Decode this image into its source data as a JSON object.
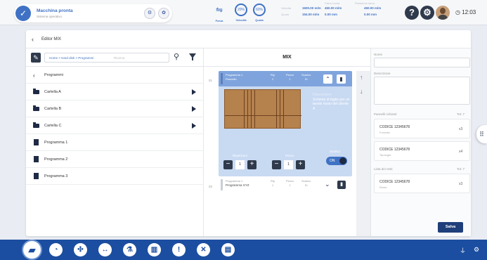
{
  "header": {
    "status_title": "Macchina pronta",
    "status_sub": "Sistema operativo",
    "indicators": [
      {
        "label": "Forza",
        "icon": "feed-icon"
      },
      {
        "label": "Velocità",
        "value": "20%"
      },
      {
        "label": "Quota",
        "value": "60%"
      }
    ],
    "stats": [
      {
        "k": "Velocità",
        "v": "1600.00 m/m"
      },
      {
        "k": "Quota",
        "v": "154.00 m/m"
      },
      {
        "k": "Carro Lama",
        "v": "450.00 m/m"
      },
      {
        "k": "Pezzo",
        "v": "0.00 mm"
      },
      {
        "k": "Rotazione lama",
        "v": "450.00 m/m"
      },
      {
        "k": "Pressione",
        "v": "0.00 mm"
      }
    ],
    "clock": "12:03"
  },
  "breadcrumb": {
    "back_label": "Editor MIX"
  },
  "toolbar": {
    "path": "Home > Hard disk > Programmi",
    "search_placeholder": "Ricerca"
  },
  "list": {
    "header": "Programmi",
    "items": [
      {
        "label": "Cartella A",
        "type": "folder"
      },
      {
        "label": "Cartella B",
        "type": "folder"
      },
      {
        "label": "Cartella C",
        "type": "folder"
      },
      {
        "label": "Programma 1",
        "type": "file"
      },
      {
        "label": "Programma 2",
        "type": "file"
      },
      {
        "label": "Programma 3",
        "type": "file"
      }
    ]
  },
  "mix": {
    "title": "MIX",
    "entries": [
      {
        "num": "01",
        "prog_label": "Programma 1",
        "prog_value": "Pannello",
        "rip_label": "Rip",
        "rip_value": "1",
        "pezzo_label": "Pezzo",
        "pezzo_value": "1",
        "scarico_label": "Scarico",
        "scarico_value": "Sì",
        "desc_label": "Descrizione:",
        "desc_text": "Schema di taglio per un tavolo rosso del cliente A",
        "ripetizioni_label": "Ripetizioni",
        "ripetizioni_value": "1",
        "pezzo_ctrl_label": "Pezzo",
        "pezzo_ctrl_value": "1",
        "scarico_ctrl_label": "Scarico",
        "toggle_label": "ON"
      },
      {
        "num": "02",
        "prog_label": "Programma 1",
        "prog_value": "Programma XYZ",
        "rip_label": "Rip",
        "rip_value": "1",
        "pezzo_label": "Pezzo",
        "pezzo_value": "1",
        "scarico_label": "Scarico",
        "scarico_value": "Sì"
      }
    ]
  },
  "details": {
    "name_label": "Nome",
    "desc_label": "Descrizione",
    "panels_label": "Pannelli richiesti",
    "panels_tot": "Tot: 7",
    "panels": [
      {
        "code": "CODICE 12345678",
        "sub": "Formato",
        "qty": "x3"
      },
      {
        "code": "CODICE 12345678",
        "sub": "Tipologia",
        "qty": "x4"
      }
    ],
    "rests_label": "Lista dei resti",
    "rests_tot": "Tot: 7",
    "rests": [
      {
        "code": "CODICE 12345678",
        "sub": "Resto",
        "qty": "x3"
      }
    ],
    "save_label": "Salva"
  },
  "colors": {
    "accent": "#3f72c4",
    "dock": "#1b4ea0",
    "card": "#c8d9f2",
    "card_head": "#7fa4dd"
  }
}
